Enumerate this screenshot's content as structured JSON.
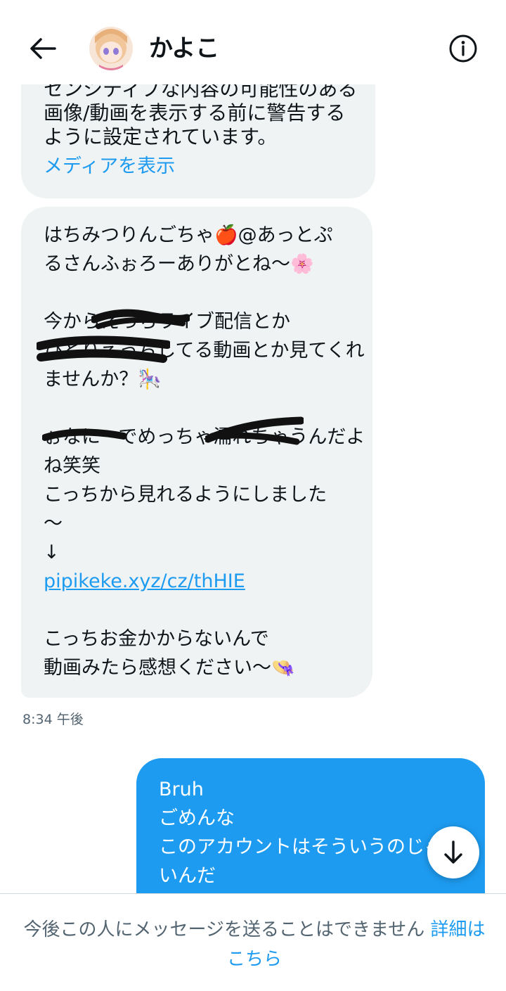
{
  "header": {
    "title": "かよこ",
    "back_icon": "arrow-left-icon",
    "info_icon": "info-circle-icon"
  },
  "media_warning": {
    "text": "センシティブな内容の可能性のある\n画像/動画を表示する前に警告する\nように設定されています。",
    "link": "メディアを表示"
  },
  "incoming": {
    "lines": [
      "はちみつりんごちゃ🍎@あっとぷ",
      "るさんふぉろーありがとね〜🌸",
      "",
      "今からえっちライブ配信とか",
      "ひとりえっちしてる動画とか見てくれ",
      "ませんか？🎠",
      "",
      "ぉなにーでめっちゃ濡れちゃうんだよ",
      "ね笑笑",
      "こっちから見れるようにしました",
      "〜",
      "↓"
    ],
    "link": "pipikeke.xyz/cz/thHIE",
    "lines_after": [
      "",
      "こっちお金かからないんで",
      "動画みたら感想ください〜👒"
    ],
    "time": "8:34 午後"
  },
  "outgoing": {
    "lines": [
      "Bruh",
      "ごめんな",
      "このアカウントはそういうのじゃな",
      "いんだ"
    ]
  },
  "scroll_icon": "arrow-down-icon",
  "footer": {
    "notice": "今後この人にメッセージを送ることはできません",
    "more_link": "詳細はこちら"
  },
  "colors": {
    "accent": "#1d9bf0",
    "bubble_in": "#eff3f4",
    "muted": "#536471"
  }
}
